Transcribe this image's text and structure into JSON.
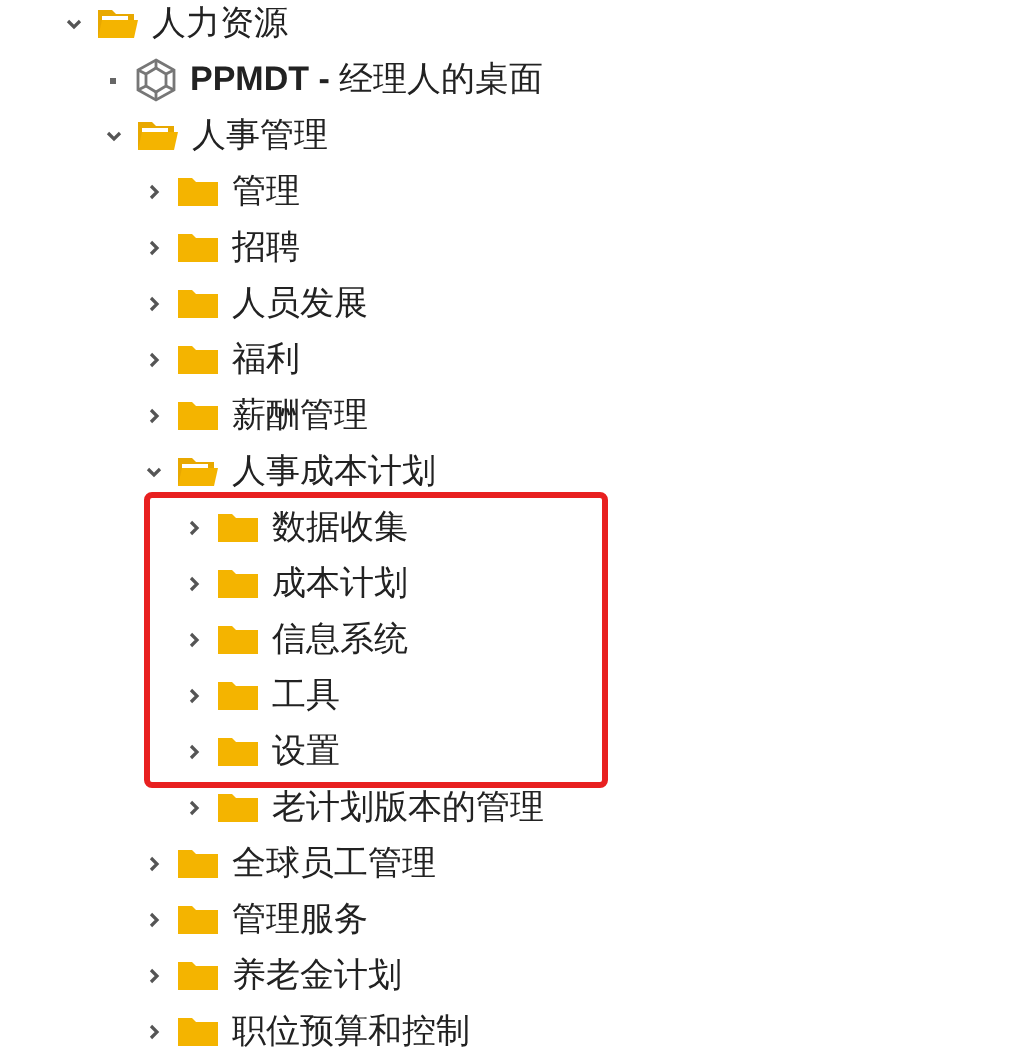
{
  "tree": [
    {
      "kind": "folder",
      "label": "人力资源",
      "expanded": true,
      "children": [
        {
          "kind": "transaction",
          "label": "**PPMDT -** 经理人的桌面"
        },
        {
          "kind": "folder",
          "label": "人事管理",
          "expanded": true,
          "children": [
            {
              "kind": "folder",
              "label": "管理",
              "expanded": false
            },
            {
              "kind": "folder",
              "label": "招聘",
              "expanded": false
            },
            {
              "kind": "folder",
              "label": "人员发展",
              "expanded": false
            },
            {
              "kind": "folder",
              "label": "福利",
              "expanded": false
            },
            {
              "kind": "folder",
              "label": "薪酬管理",
              "expanded": false
            },
            {
              "kind": "folder",
              "label": "人事成本计划",
              "expanded": true,
              "children": [
                {
                  "kind": "folder",
                  "label": "数据收集",
                  "expanded": false,
                  "highlighted": true
                },
                {
                  "kind": "folder",
                  "label": "成本计划",
                  "expanded": false,
                  "highlighted": true
                },
                {
                  "kind": "folder",
                  "label": "信息系统",
                  "expanded": false,
                  "highlighted": true
                },
                {
                  "kind": "folder",
                  "label": "工具",
                  "expanded": false,
                  "highlighted": true
                },
                {
                  "kind": "folder",
                  "label": "设置",
                  "expanded": false,
                  "highlighted": true
                },
                {
                  "kind": "folder",
                  "label": "老计划版本的管理",
                  "expanded": false,
                  "highlighted": false
                }
              ]
            },
            {
              "kind": "folder",
              "label": "全球员工管理",
              "expanded": false
            },
            {
              "kind": "folder",
              "label": "管理服务",
              "expanded": false
            },
            {
              "kind": "folder",
              "label": "养老金计划",
              "expanded": false
            },
            {
              "kind": "folder",
              "label": "职位预算和控制",
              "expanded": false
            }
          ]
        }
      ]
    }
  ]
}
